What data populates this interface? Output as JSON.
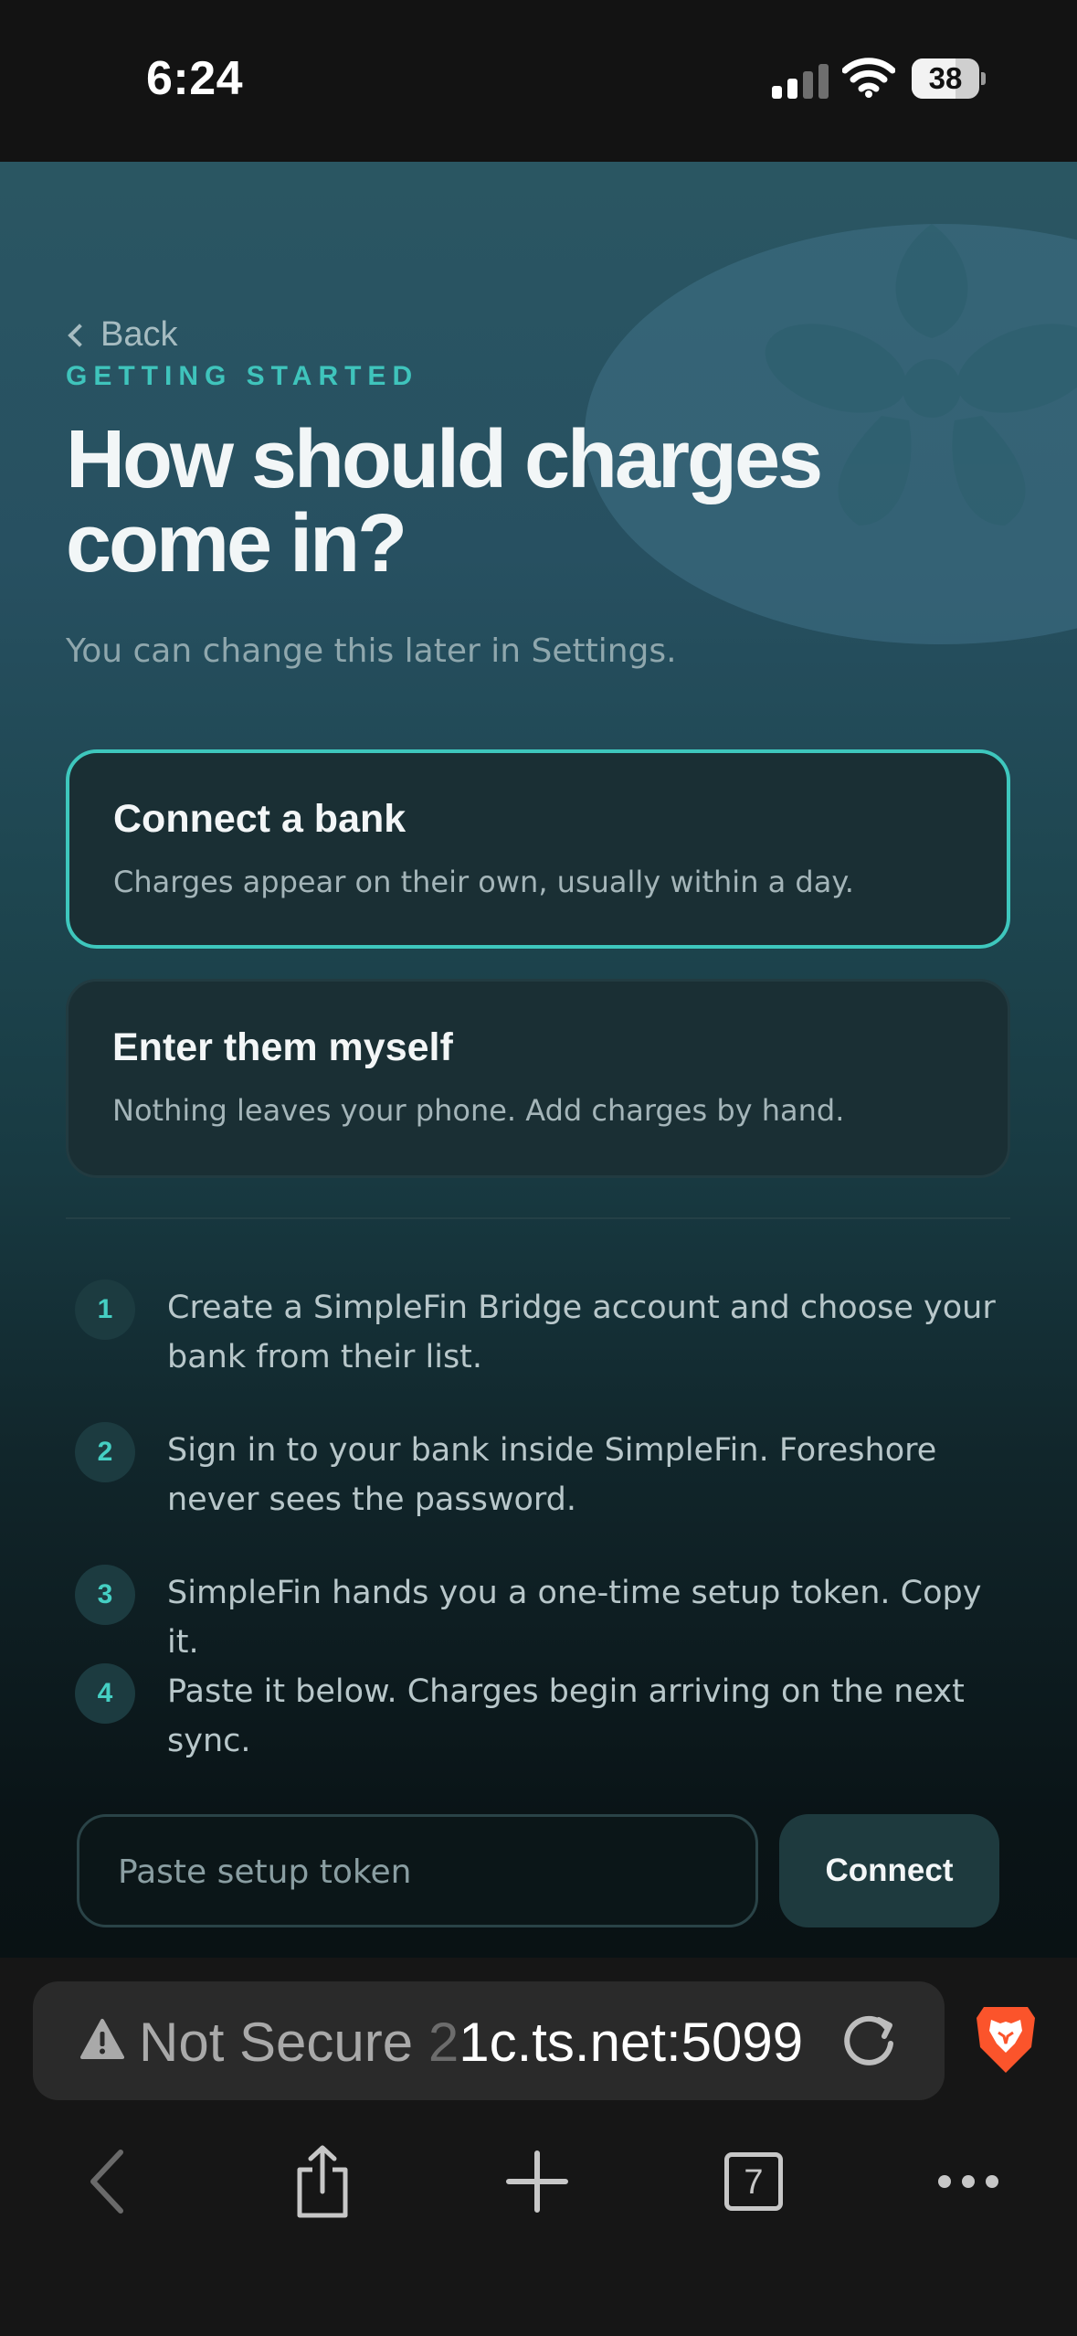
{
  "status_bar": {
    "time": "6:24",
    "battery_percent": "38",
    "signal_bars_active": 2,
    "icons": [
      "cellular-signal-icon",
      "wifi-icon",
      "battery-icon"
    ]
  },
  "screen": {
    "back_label": "Back",
    "eyebrow": "GETTING STARTED",
    "title": "How should charges come in?",
    "subtitle": "You can change this later in Settings.",
    "options": [
      {
        "title": "Connect a bank",
        "description": "Charges appear on their own, usually within a day.",
        "selected": true
      },
      {
        "title": "Enter them myself",
        "description": "Nothing leaves your phone. Add charges by hand.",
        "selected": false
      }
    ],
    "steps": [
      {
        "number": "1",
        "text": "Create a SimpleFin Bridge account and choose your bank from their list."
      },
      {
        "number": "2",
        "text": "Sign in to your bank inside SimpleFin. Foreshore never sees the password."
      },
      {
        "number": "3",
        "text": "SimpleFin hands you a one-time setup token. Copy it."
      },
      {
        "number": "4",
        "text": "Paste it below. Charges begin arriving on the next sync."
      }
    ],
    "token_input": {
      "placeholder": "Paste setup token",
      "value": ""
    },
    "connect_label": "Connect"
  },
  "browser": {
    "security_label": "Not Secure",
    "url_faded": "2",
    "url_text": "1c.ts.net:5099",
    "tab_count": "7",
    "icons": [
      "warning-icon",
      "reload-icon",
      "brave-lion-icon",
      "back-arrow-icon",
      "share-icon",
      "new-tab-icon",
      "tabs-icon",
      "more-icon"
    ]
  },
  "colors": {
    "accent": "#3ec7bd",
    "card_background": "#1a2f34",
    "background_top": "#2a5662",
    "background_bottom": "#091214",
    "brave_orange": "#fb542b"
  }
}
